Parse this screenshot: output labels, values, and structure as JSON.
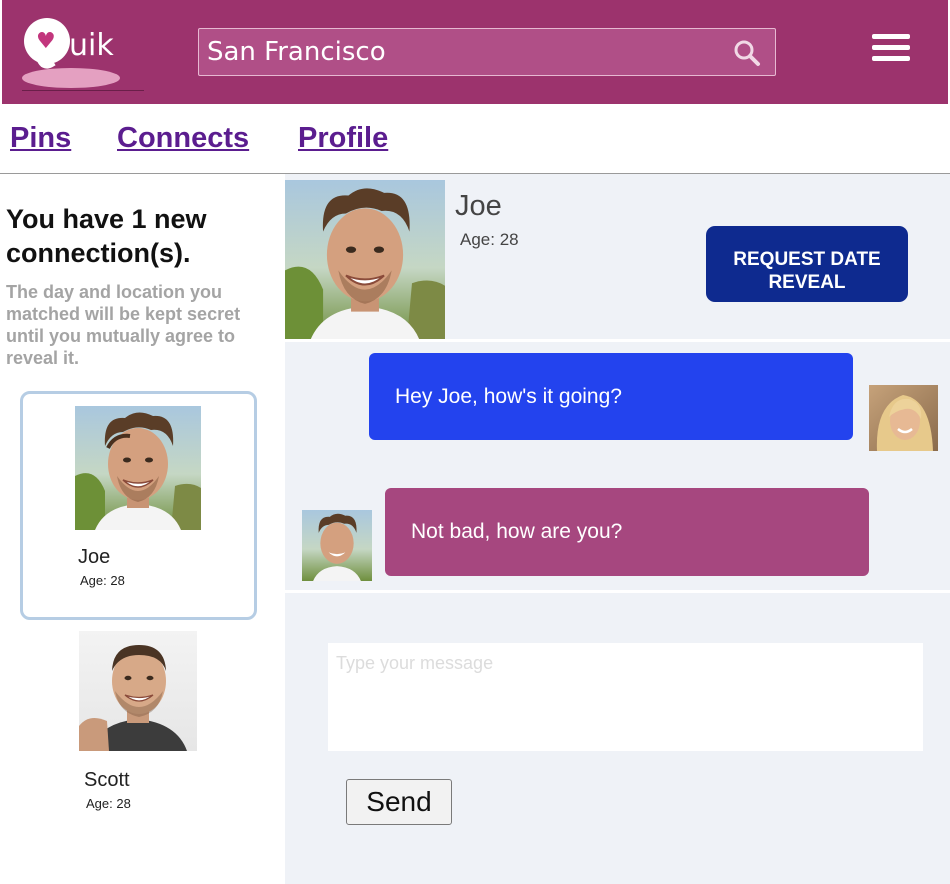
{
  "app": {
    "logo_text": "uik"
  },
  "header": {
    "search_value": "San Francisco",
    "search_icon": "search-icon",
    "menu_icon": "hamburger-menu-icon"
  },
  "nav": {
    "items": [
      "Pins",
      "Connects",
      "Profile"
    ]
  },
  "sidebar": {
    "notice_title": "You have 1 new connection(s).",
    "notice_text": "The day and location you matched will be kept secret until you mutually agree to reveal it.",
    "connections": [
      {
        "name": "Joe",
        "age": "Age: 28",
        "selected": true
      },
      {
        "name": "Scott",
        "age": "Age: 28",
        "selected": false
      }
    ]
  },
  "chat": {
    "name": "Joe",
    "age": "Age: 28",
    "reveal_button": "REQUEST DATE REVEAL",
    "messages": [
      {
        "text": "Hey Joe, how's it going?",
        "from": "me",
        "color": "#2343ee"
      },
      {
        "text": "Not bad, how are you?",
        "from": "Joe",
        "color": "#a6477f"
      }
    ],
    "input_placeholder": "Type your message",
    "input_value": "",
    "send_label": "Send"
  },
  "colors": {
    "header": "#9c336d",
    "nav_link": "#5b1d8f",
    "reveal_button": "#0e2a8f",
    "my_bubble": "#2343ee",
    "their_bubble": "#a6477f",
    "chat_bg": "#eff2f7"
  }
}
